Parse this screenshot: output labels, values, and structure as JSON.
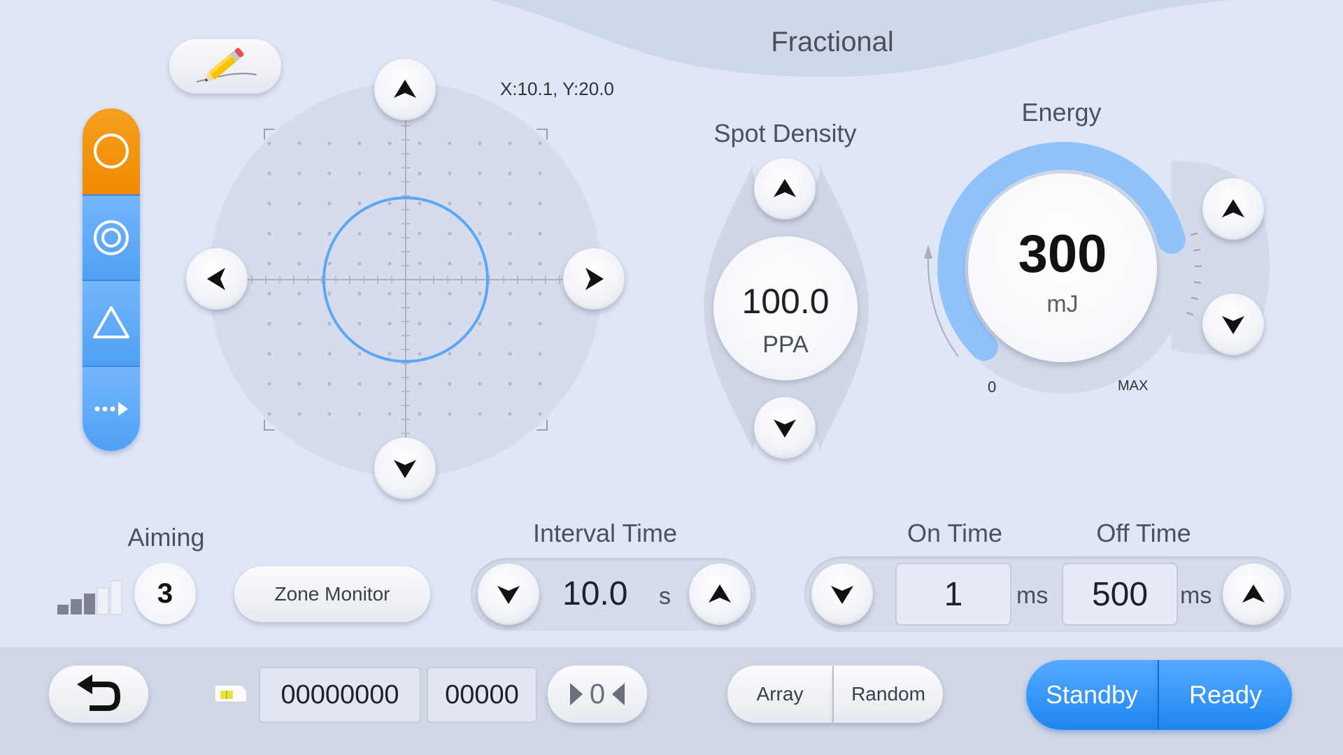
{
  "header": {
    "title": "Fractional"
  },
  "scan_area": {
    "coordinates": "X:10.1,  Y:20.0"
  },
  "shape_selector": {
    "items": [
      {
        "icon": "circle-icon",
        "active": true
      },
      {
        "icon": "concentric-circle-icon",
        "active": false
      },
      {
        "icon": "triangle-icon",
        "active": false
      },
      {
        "icon": "dotted-arrow-icon",
        "active": false
      }
    ]
  },
  "spot_density": {
    "label": "Spot Density",
    "value": "100.0",
    "unit": "PPA"
  },
  "energy": {
    "label": "Energy",
    "value": "300",
    "unit": "mJ",
    "min_label": "0",
    "max_label": "MAX"
  },
  "aiming": {
    "label": "Aiming",
    "level": "3"
  },
  "zone_monitor": {
    "label": "Zone Monitor"
  },
  "interval_time": {
    "label": "Interval Time",
    "value": "10.0",
    "unit": "s"
  },
  "on_time": {
    "label": "On Time",
    "value": "1",
    "unit": "ms"
  },
  "off_time": {
    "label": "Off Time",
    "value": "500",
    "unit": "ms"
  },
  "footer": {
    "total_counter": "00000000",
    "session_counter": "00000",
    "reset_label": "0",
    "pattern_options": [
      "Array",
      "Random"
    ],
    "mode_options": [
      "Standby",
      "Ready"
    ]
  },
  "colors": {
    "accent_blue": "#3d99f5",
    "active_orange": "#f39200",
    "background": "#dfe6f7"
  }
}
